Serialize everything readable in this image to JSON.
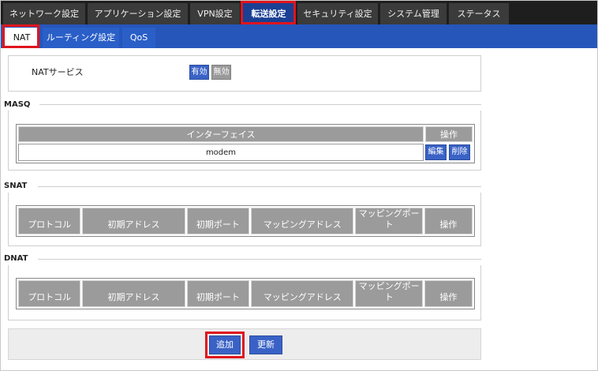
{
  "topnav": {
    "tabs": [
      {
        "label": "ネットワーク設定"
      },
      {
        "label": "アプリケーション設定"
      },
      {
        "label": "VPN設定"
      },
      {
        "label": "転送設定"
      },
      {
        "label": "セキュリティ設定"
      },
      {
        "label": "システム管理"
      },
      {
        "label": "ステータス"
      }
    ],
    "active": "転送設定"
  },
  "subnav": {
    "tabs": [
      {
        "label": "NAT"
      },
      {
        "label": "ルーティング設定"
      },
      {
        "label": "QoS"
      }
    ],
    "active": "NAT"
  },
  "nat_service": {
    "label": "NATサービス",
    "enable_label": "有効",
    "disable_label": "無効"
  },
  "masq": {
    "title": "MASQ",
    "headers": {
      "interface": "インターフェイス",
      "action": "操作"
    },
    "rows": [
      {
        "interface": "modem",
        "edit_label": "編集",
        "delete_label": "削除"
      }
    ]
  },
  "snat": {
    "title": "SNAT",
    "headers": [
      "プロトコル",
      "初期アドレス",
      "初期ポート",
      "マッピングアドレス",
      "マッピングポート",
      "操作"
    ]
  },
  "dnat": {
    "title": "DNAT",
    "headers": [
      "プロトコル",
      "初期アドレス",
      "初期ポート",
      "マッピングアドレス",
      "マッピングポート",
      "操作"
    ]
  },
  "footer": {
    "add_label": "追加",
    "update_label": "更新"
  },
  "colors": {
    "highlight": "#e0141c",
    "nav_dark": "#1e1e1e",
    "nav_active": "#1a3f93",
    "subnav": "#2656ba",
    "button_blue": "#3a62c6",
    "header_gray": "#9b9b9b"
  }
}
